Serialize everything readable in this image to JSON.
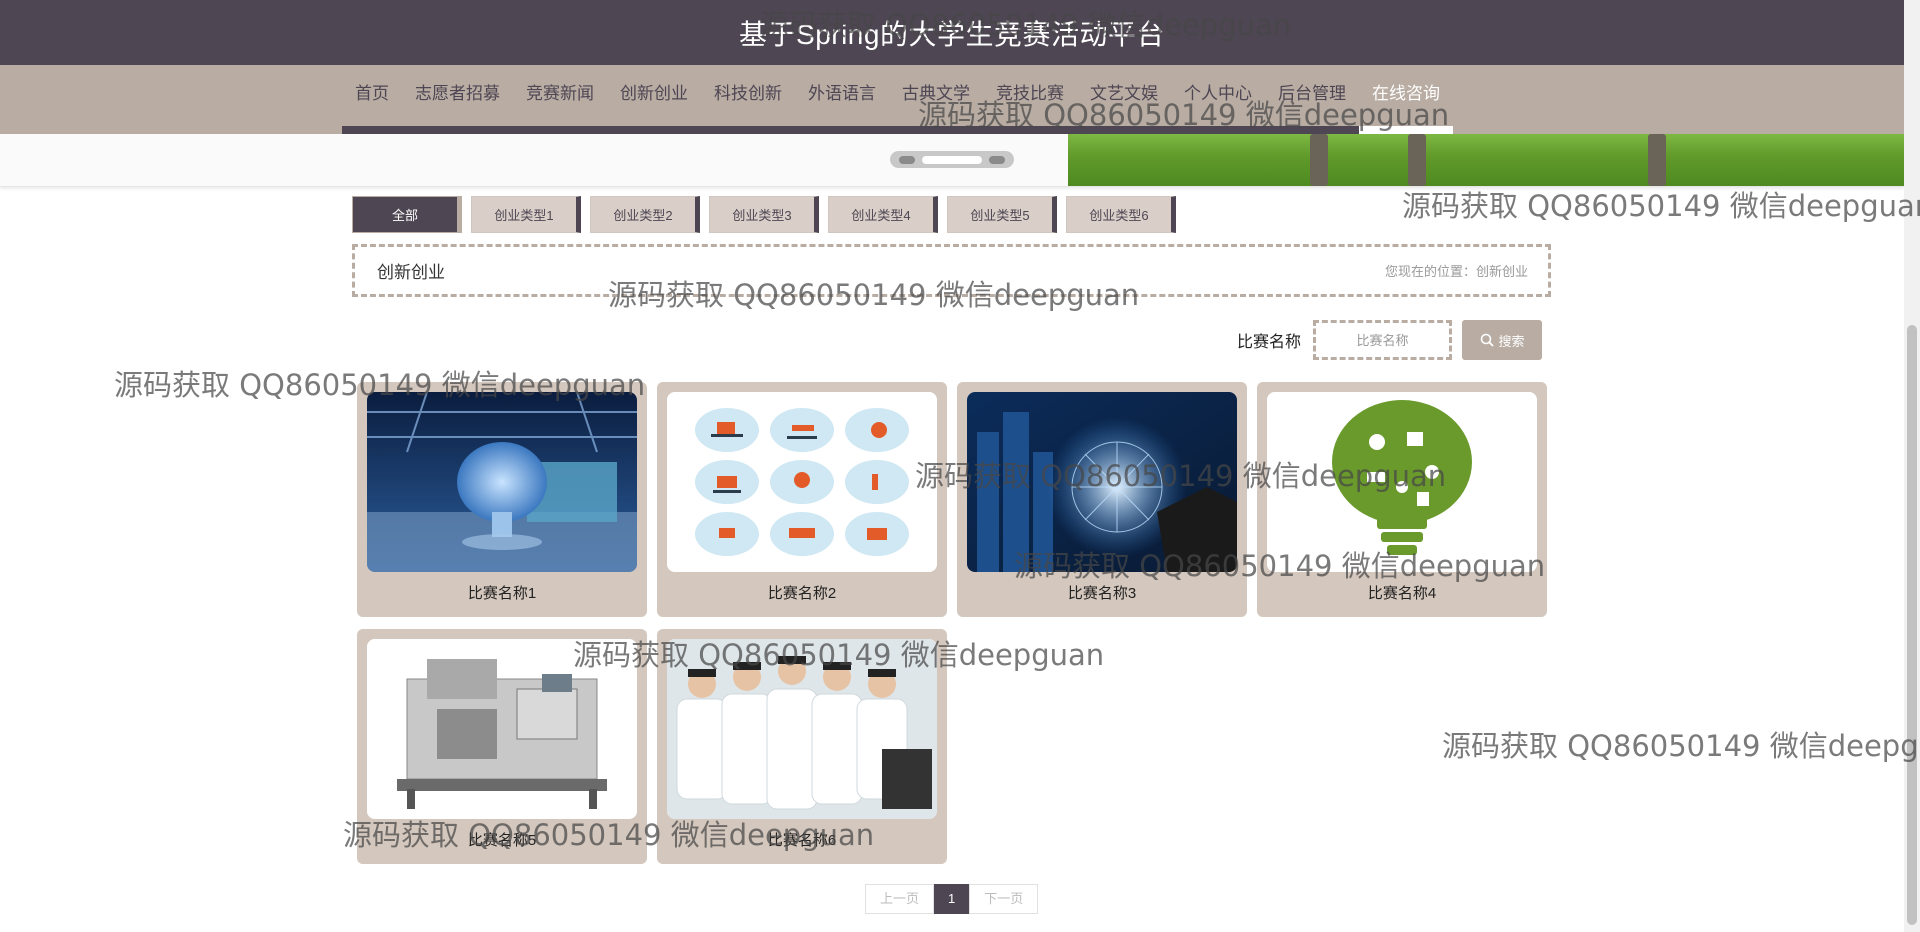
{
  "header": {
    "title": "基于Spring的大学生竞赛活动平台"
  },
  "nav": {
    "items": [
      {
        "label": "首页"
      },
      {
        "label": "志愿者招募"
      },
      {
        "label": "竞赛新闻"
      },
      {
        "label": "创新创业"
      },
      {
        "label": "科技创新"
      },
      {
        "label": "外语语言"
      },
      {
        "label": "古典文学"
      },
      {
        "label": "竞技比赛"
      },
      {
        "label": "文艺文娱"
      },
      {
        "label": "个人中心"
      },
      {
        "label": "后台管理"
      },
      {
        "label": "在线咨询"
      }
    ]
  },
  "tabs": [
    {
      "label": "全部"
    },
    {
      "label": "创业类型1"
    },
    {
      "label": "创业类型2"
    },
    {
      "label": "创业类型3"
    },
    {
      "label": "创业类型4"
    },
    {
      "label": "创业类型5"
    },
    {
      "label": "创业类型6"
    }
  ],
  "section": {
    "title": "创新创业",
    "location": "您现在的位置：创新创业"
  },
  "search": {
    "label": "比赛名称",
    "placeholder": "比赛名称",
    "button": "搜索"
  },
  "cards": [
    {
      "name": "比赛名称1"
    },
    {
      "name": "比赛名称2"
    },
    {
      "name": "比赛名称3"
    },
    {
      "name": "比赛名称4"
    },
    {
      "name": "比赛名称5"
    },
    {
      "name": "比赛名称6"
    }
  ],
  "pagination": {
    "prev": "上一页",
    "current": "1",
    "next": "下一页"
  },
  "watermark": "源码获取 QQ86050149 微信deepguan",
  "colors": {
    "header": "#4e4653",
    "nav": "#b8aca3",
    "card": "#d4c7bd"
  }
}
